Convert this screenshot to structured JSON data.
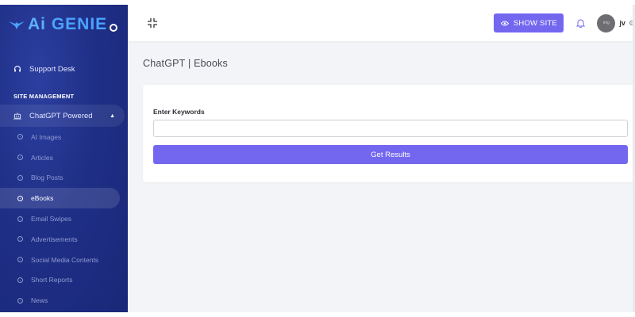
{
  "brand": {
    "name_ai": "Ai",
    "name_rest": "GENIE"
  },
  "sidebar": {
    "support": "Support Desk",
    "section": "SITE MANAGEMENT",
    "group": "ChatGPT Powered",
    "items": [
      {
        "label": "AI Images"
      },
      {
        "label": "Articles"
      },
      {
        "label": "Blog Posts"
      },
      {
        "label": "eBooks"
      },
      {
        "label": "Email Swipes"
      },
      {
        "label": "Advertisements"
      },
      {
        "label": "Social Media Contents"
      },
      {
        "label": "Short Reports"
      },
      {
        "label": "News"
      }
    ]
  },
  "topbar": {
    "show_site": "SHOW SITE",
    "user_name": "jv",
    "avatar_text": "img"
  },
  "page": {
    "title": "ChatGPT | Ebooks"
  },
  "form": {
    "label": "Enter Keywords",
    "value": "",
    "button": "Get Results"
  },
  "colors": {
    "accent": "#7367f0",
    "sidebar_bg": "#1f2f86"
  }
}
